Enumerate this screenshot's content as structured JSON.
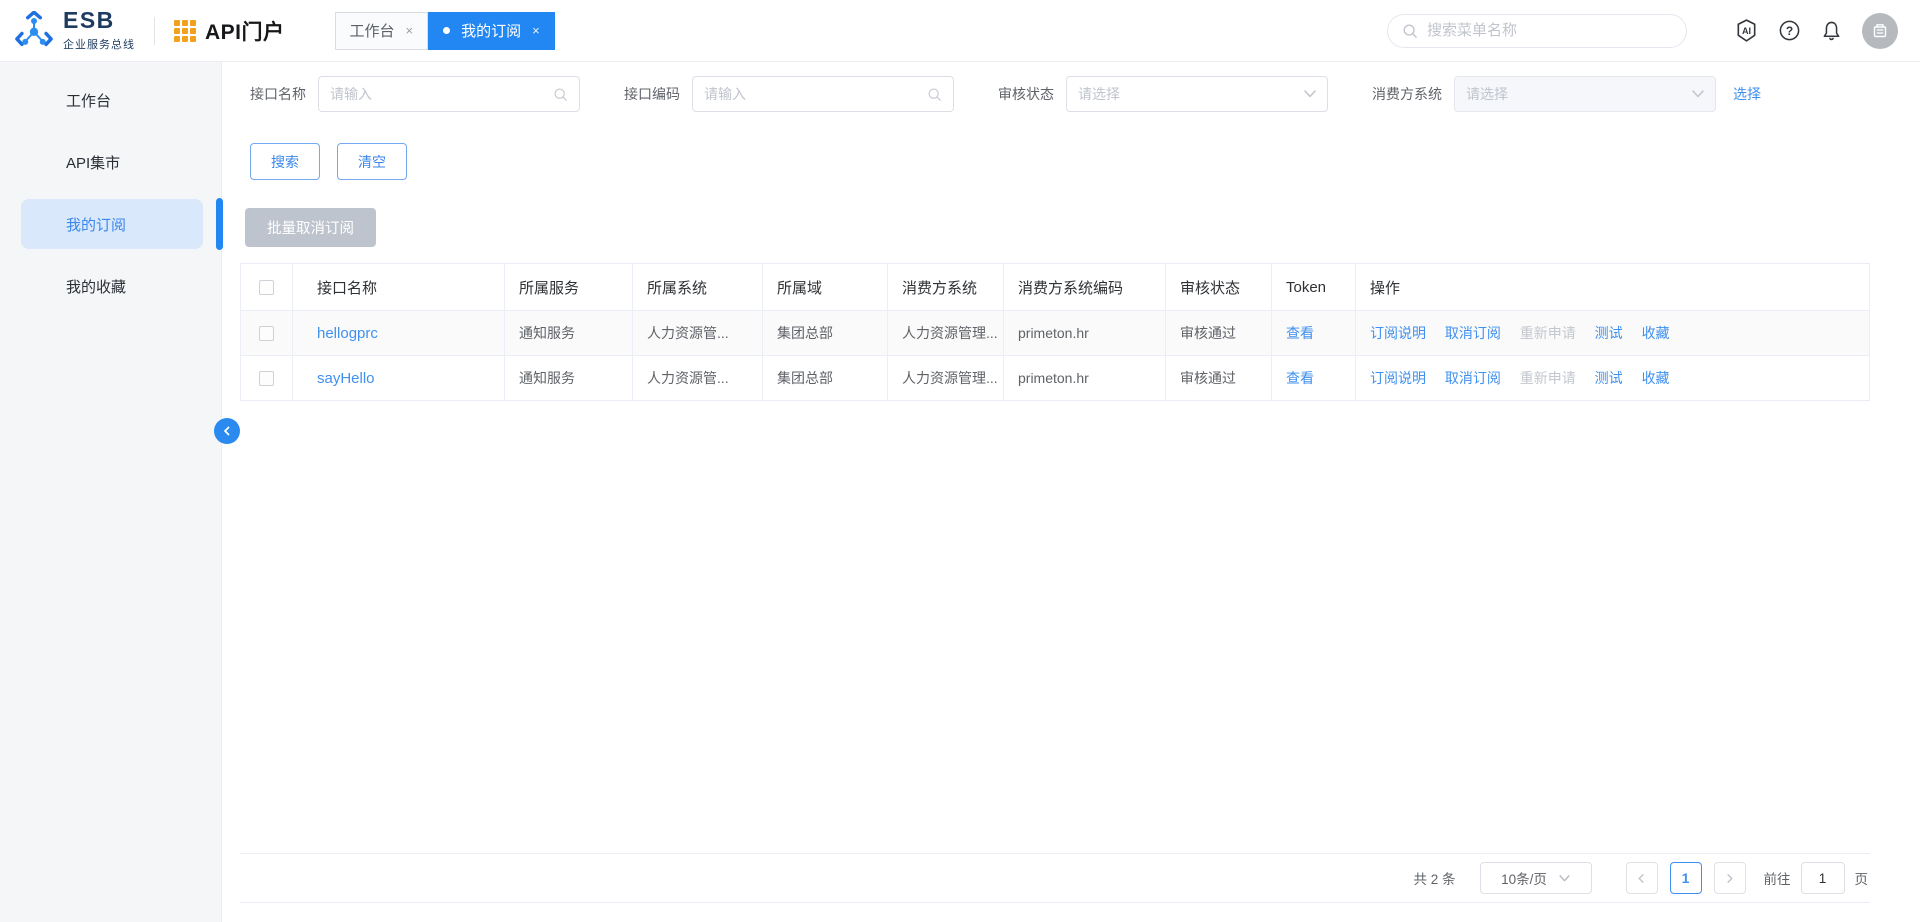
{
  "colors": {
    "primary": "#2287f2",
    "link": "#4090ef",
    "disabled_text": "#c0c4cc",
    "sidebar_active_bg": "#d9e8fb"
  },
  "header": {
    "logo_title": "ESB",
    "logo_subtitle": "企业服务总线",
    "portal_title": "API门户",
    "tabs": [
      {
        "label": "工作台"
      },
      {
        "label": "我的订阅"
      }
    ],
    "close_glyph": "×",
    "search_placeholder": "搜索菜单名称"
  },
  "sidebar": {
    "items": [
      {
        "label": "工作台"
      },
      {
        "label": "API集市"
      },
      {
        "label": "我的订阅"
      },
      {
        "label": "我的收藏"
      }
    ]
  },
  "filters": {
    "fields": [
      {
        "label": "接口名称",
        "placeholder": "请输入"
      },
      {
        "label": "接口编码",
        "placeholder": "请输入"
      },
      {
        "label": "审核状态",
        "placeholder": "请选择"
      },
      {
        "label": "消费方系统",
        "placeholder": "请选择"
      }
    ],
    "select_link": "选择",
    "search_button": "搜索",
    "clear_button": "清空",
    "batch_button": "批量取消订阅"
  },
  "table": {
    "headers": [
      "接口名称",
      "所属服务",
      "所属系统",
      "所属域",
      "消费方系统",
      "消费方系统编码",
      "审核状态",
      "Token",
      "操作"
    ],
    "token_link": "查看",
    "actions": [
      "订阅说明",
      "取消订阅",
      "重新申请",
      "测试",
      "收藏"
    ],
    "rows": [
      {
        "name": "hellogprc",
        "service": "通知服务",
        "system": "人力资源管...",
        "domain": "集团总部",
        "consumer": "人力资源管理...",
        "consumer_code": "primeton.hr",
        "status": "审核通过"
      },
      {
        "name": "sayHello",
        "service": "通知服务",
        "system": "人力资源管...",
        "domain": "集团总部",
        "consumer": "人力资源管理...",
        "consumer_code": "primeton.hr",
        "status": "审核通过"
      }
    ]
  },
  "pagination": {
    "total": "共 2 条",
    "page_size": "10条/页",
    "current_page": "1",
    "goto_label": "前往",
    "goto_value": "1",
    "unit_label": "页"
  }
}
